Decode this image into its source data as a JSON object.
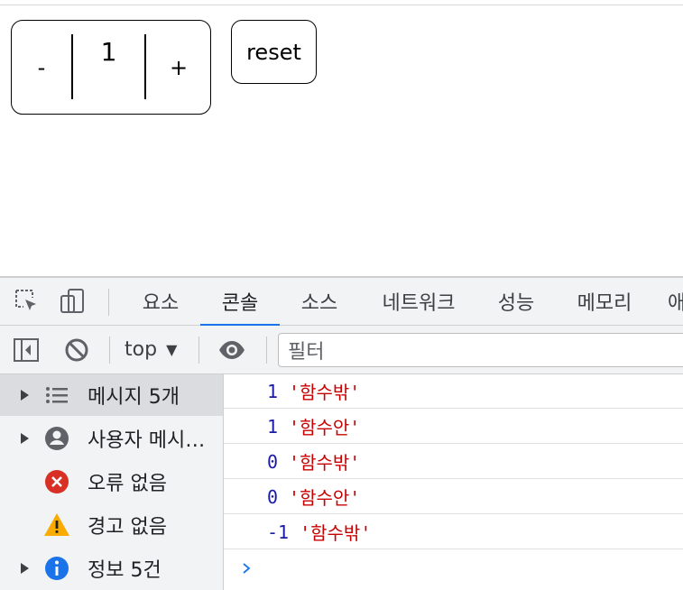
{
  "app": {
    "counter": {
      "minus_label": "-",
      "value": "1",
      "plus_label": "+"
    },
    "reset_label": "reset"
  },
  "devtools": {
    "tabs": [
      {
        "label": "요소"
      },
      {
        "label": "콘솔",
        "active": true
      },
      {
        "label": "소스"
      },
      {
        "label": "네트워크"
      },
      {
        "label": "성능"
      },
      {
        "label": "메모리"
      },
      {
        "label": "애"
      }
    ],
    "toolbar": {
      "context": "top",
      "filter_placeholder": "필터"
    },
    "sidebar": [
      {
        "label": "메시지 5개",
        "icon": "list-icon",
        "selected": true
      },
      {
        "label": "사용자 메시…",
        "icon": "user-icon"
      },
      {
        "label": "오류 없음",
        "icon": "error-icon"
      },
      {
        "label": "경고 없음",
        "icon": "warning-icon"
      },
      {
        "label": "정보 5건",
        "icon": "info-icon"
      }
    ],
    "console_logs": [
      {
        "num": "1",
        "str": "'함수밖'"
      },
      {
        "num": "1",
        "str": "'함수안'"
      },
      {
        "num": "0",
        "str": "'함수밖'"
      },
      {
        "num": "0",
        "str": "'함수안'"
      },
      {
        "num": "-1",
        "str": "'함수밖'"
      }
    ],
    "colors": {
      "active_tab_underline": "#1a73e8",
      "log_number": "#1a1aa6",
      "log_string": "#c80000",
      "error": "#d93025",
      "warning": "#f9ab00",
      "info": "#1a73e8"
    }
  }
}
